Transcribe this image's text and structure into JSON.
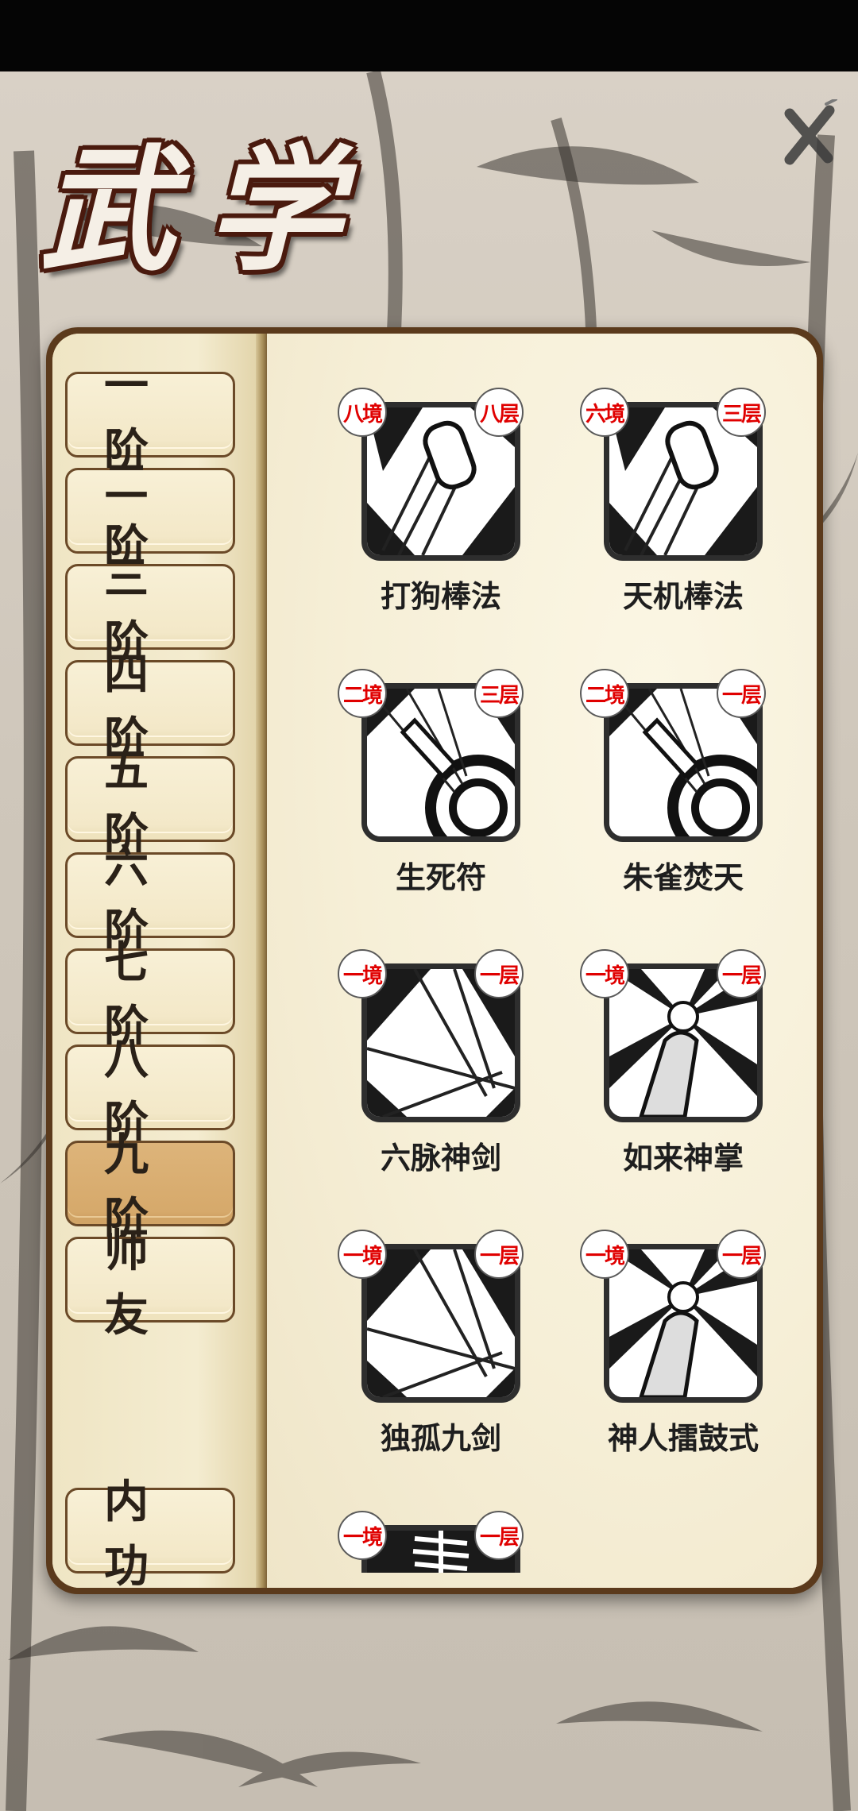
{
  "title": {
    "char1": "武",
    "char2": "学"
  },
  "close_label": "close",
  "tabs": [
    {
      "label": "一阶",
      "c1": "一",
      "c2": "阶",
      "active": false
    },
    {
      "label": "二阶",
      "c1": "二",
      "c2": "阶",
      "active": false
    },
    {
      "label": "三阶",
      "c1": "三",
      "c2": "阶",
      "active": false
    },
    {
      "label": "四阶",
      "c1": "四",
      "c2": "阶",
      "active": false
    },
    {
      "label": "五阶",
      "c1": "五",
      "c2": "阶",
      "active": false
    },
    {
      "label": "六阶",
      "c1": "六",
      "c2": "阶",
      "active": false
    },
    {
      "label": "七阶",
      "c1": "七",
      "c2": "阶",
      "active": false
    },
    {
      "label": "八阶",
      "c1": "八",
      "c2": "阶",
      "active": false
    },
    {
      "label": "九阶",
      "c1": "九",
      "c2": "阶",
      "active": true
    },
    {
      "label": "师友",
      "c1": "师",
      "c2": "友",
      "active": false
    }
  ],
  "neigong_tab": {
    "c1": "内",
    "c2": "功"
  },
  "skills": [
    {
      "name": "打狗棒法",
      "realm": "八境",
      "level": "八层",
      "icon": "staff-strike-icon"
    },
    {
      "name": "天机棒法",
      "realm": "六境",
      "level": "三层",
      "icon": "staff-strike-icon"
    },
    {
      "name": "生死符",
      "realm": "二境",
      "level": "三层",
      "icon": "needle-throw-icon"
    },
    {
      "name": "朱雀焚天",
      "realm": "二境",
      "level": "一层",
      "icon": "needle-throw-icon"
    },
    {
      "name": "六脉神剑",
      "realm": "一境",
      "level": "一层",
      "icon": "sword-burst-icon"
    },
    {
      "name": "如来神掌",
      "realm": "一境",
      "level": "一层",
      "icon": "palm-burst-icon"
    },
    {
      "name": "独孤九剑",
      "realm": "一境",
      "level": "一层",
      "icon": "sword-burst-icon"
    },
    {
      "name": "神人擂鼓式",
      "realm": "一境",
      "level": "一层",
      "icon": "palm-burst-icon"
    },
    {
      "name": "",
      "realm": "一境",
      "level": "一层",
      "icon": "skeleton-icon"
    }
  ],
  "colors": {
    "badge_text": "#e00000",
    "active_tab": "#d6a96b",
    "book_border": "#5b3a1c",
    "paper": "#f3ecd3"
  }
}
